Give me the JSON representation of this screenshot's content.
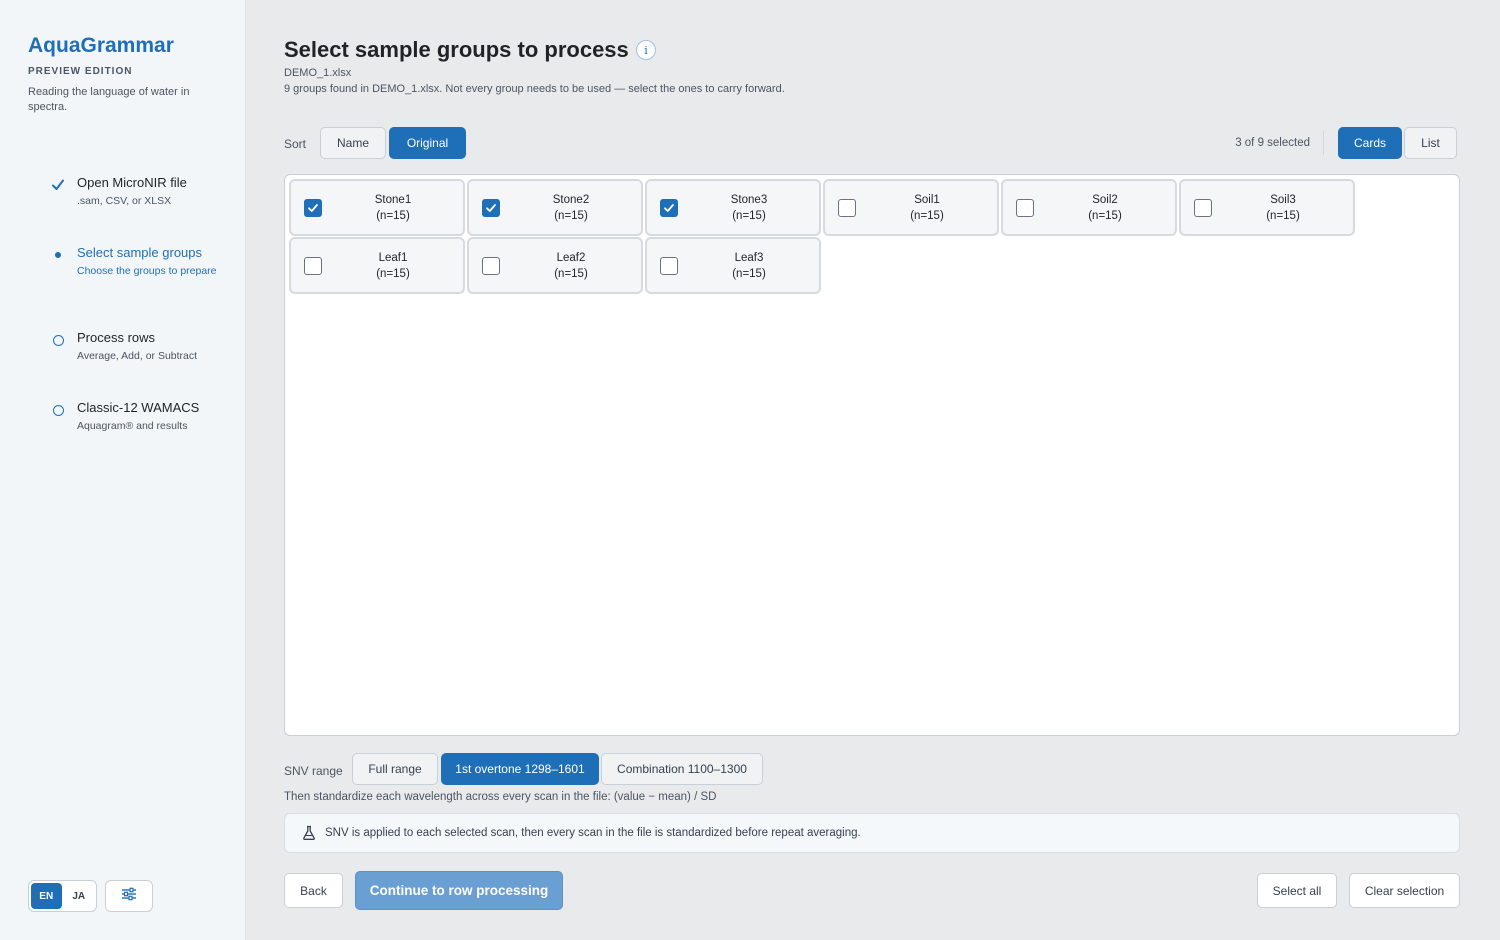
{
  "app": {
    "name": "AquaGrammar",
    "edition": "PREVIEW EDITION",
    "tagline": "Reading the language of water in spectra."
  },
  "steps": [
    {
      "title": "Open MicroNIR file",
      "sub": ".sam, CSV, or XLSX",
      "state": "done",
      "icon": "check-icon"
    },
    {
      "title": "Select sample groups",
      "sub": "Choose the groups to prepare",
      "state": "active",
      "icon": "dot-icon"
    },
    {
      "title": "Process rows",
      "sub": "Average, Add, or Subtract",
      "state": "todo",
      "icon": "circle-icon"
    },
    {
      "title": "Classic-12 WAMACS",
      "sub": "Aquagram® and results",
      "state": "todo",
      "icon": "circle-icon"
    }
  ],
  "language": {
    "options": [
      "EN",
      "JA"
    ],
    "selected": "EN"
  },
  "settings_icon": "sliders-icon",
  "header": {
    "title": "Select sample groups to process",
    "info_glyph": "i",
    "filename": "DEMO_1.xlsx",
    "description": "9 groups found in DEMO_1.xlsx. Not every group needs to be used — select the ones to carry forward."
  },
  "toolbar": {
    "sort_label": "Sort",
    "sort_options": [
      "Name",
      "Original"
    ],
    "sort_selected": "Original",
    "selected_count": "3 of 9 selected",
    "view_options": [
      "Cards",
      "List"
    ],
    "view_selected": "Cards"
  },
  "groups": [
    {
      "name": "Stone1",
      "n": "(n=15)",
      "checked": true
    },
    {
      "name": "Stone2",
      "n": "(n=15)",
      "checked": true
    },
    {
      "name": "Stone3",
      "n": "(n=15)",
      "checked": true
    },
    {
      "name": "Soil1",
      "n": "(n=15)",
      "checked": false
    },
    {
      "name": "Soil2",
      "n": "(n=15)",
      "checked": false
    },
    {
      "name": "Soil3",
      "n": "(n=15)",
      "checked": false
    },
    {
      "name": "Leaf1",
      "n": "(n=15)",
      "checked": false
    },
    {
      "name": "Leaf2",
      "n": "(n=15)",
      "checked": false
    },
    {
      "name": "Leaf3",
      "n": "(n=15)",
      "checked": false
    }
  ],
  "snv": {
    "label": "SNV range",
    "options": [
      "Full range",
      "1st overtone 1298–1601",
      "Combination 1100–1300"
    ],
    "selected": "1st overtone 1298–1601",
    "note": "Then standardize each wavelength across every scan in the file: (value − mean) / SD",
    "notice": "SNV is applied to each selected scan, then every scan in the file is standardized before repeat averaging.",
    "notice_icon": "flask-icon"
  },
  "footer": {
    "back": "Back",
    "continue": "Continue to row processing",
    "select_all": "Select all",
    "clear_selection": "Clear selection"
  },
  "colors": {
    "accent": "#1f6fb8",
    "continue_disabled": "#6a9fd3"
  }
}
